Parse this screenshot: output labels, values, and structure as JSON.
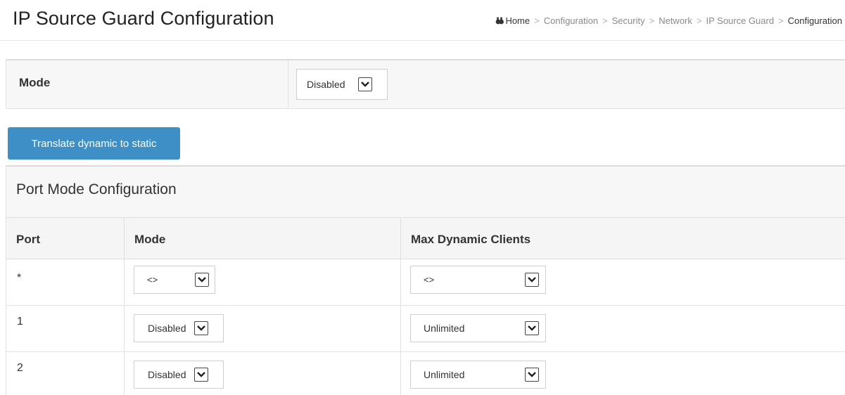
{
  "header": {
    "title": "IP Source Guard Configuration",
    "breadcrumb": {
      "home": "Home",
      "items": [
        "Configuration",
        "Security",
        "Network",
        "IP Source Guard"
      ],
      "current": "Configuration"
    }
  },
  "mode_section": {
    "label": "Mode",
    "value": "Disabled"
  },
  "actions": {
    "translate_label": "Translate dynamic to static"
  },
  "port_config": {
    "title": "Port Mode Configuration",
    "columns": [
      "Port",
      "Mode",
      "Max Dynamic Clients"
    ],
    "rows": [
      {
        "port": "*",
        "mode": "<>",
        "max_clients": "<>"
      },
      {
        "port": "1",
        "mode": "Disabled",
        "max_clients": "Unlimited"
      },
      {
        "port": "2",
        "mode": "Disabled",
        "max_clients": "Unlimited"
      }
    ]
  },
  "colors": {
    "button_primary": "#3d8fc6",
    "panel_background": "#f7f7f7"
  },
  "icons": {
    "home": "home-icon",
    "select_arrow": "chevron-down-icon"
  }
}
